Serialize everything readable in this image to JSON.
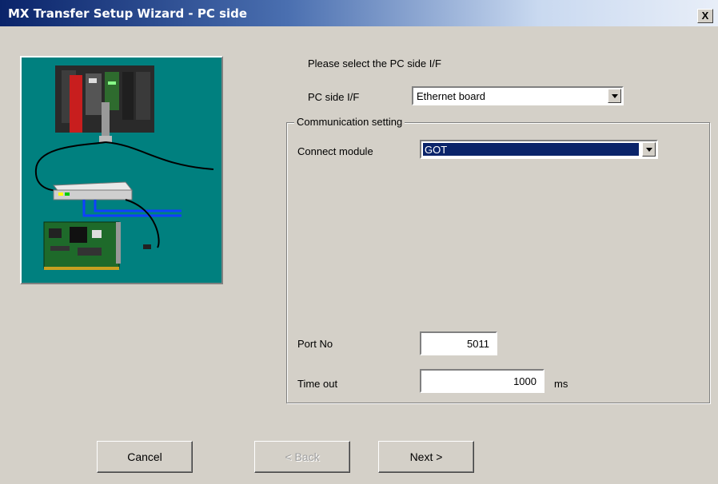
{
  "window": {
    "title": "MX Transfer Setup Wizard - PC side",
    "close_label": "X"
  },
  "prompt": "Please select the PC side I/F",
  "pc_side_if": {
    "label": "PC side I/F",
    "value": "Ethernet board"
  },
  "communication_setting": {
    "legend": "Communication setting",
    "connect_module": {
      "label": "Connect module",
      "value": "GOT"
    },
    "port_no": {
      "label": "Port No",
      "value": "5011"
    },
    "time_out": {
      "label": "Time out",
      "value": "1000",
      "unit": "ms"
    }
  },
  "buttons": {
    "cancel": "Cancel",
    "back": "< Back",
    "next": "Next >"
  },
  "colors": {
    "title_bar": "#0a246a",
    "illustration_bg": "#00807f",
    "face": "#d4d0c8",
    "selection": "#0a246a"
  }
}
